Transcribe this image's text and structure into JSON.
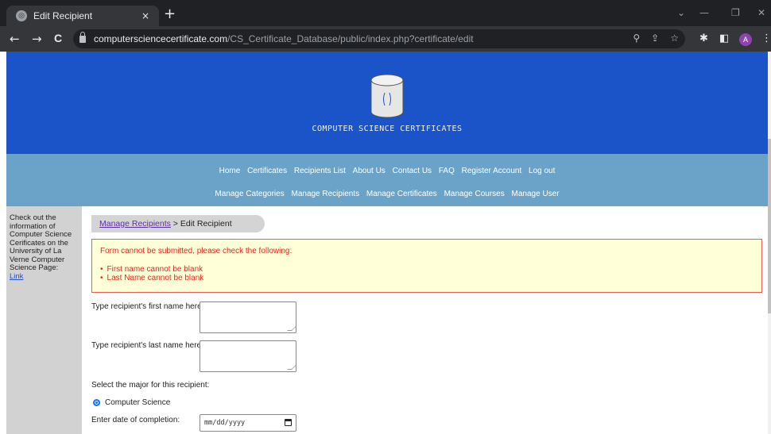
{
  "browser": {
    "tab_title": "Edit Recipient",
    "tab_close": "×",
    "new_tab": "+",
    "url_host": "computersciencecertificate.com",
    "url_path": "/CS_Certificate_Database/public/index.php?certificate/edit",
    "back": "←",
    "forward": "→",
    "reload": "C",
    "profile_initial": "A",
    "window_controls": {
      "dropdown": "⌄",
      "minimize": "—",
      "restore": "❐",
      "close": "✕"
    }
  },
  "site": {
    "logo_text": "COMPUTER SCIENCE CERTIFICATES",
    "nav_primary": [
      "Home",
      "Certificates",
      "Recipients List",
      "About Us",
      "Contact Us",
      "FAQ",
      "Register Account",
      "Log out"
    ],
    "nav_secondary": [
      "Manage Categories",
      "Manage Recipients",
      "Manage Certificates",
      "Manage Courses",
      "Manage User"
    ]
  },
  "sidebar": {
    "text": "Check out the information of Computer Science Cerificates on the University of La Verne Computer Science Page:",
    "link": "Link"
  },
  "breadcrumb": {
    "parent": "Manage Recipients",
    "separator": " > ",
    "current": "Edit Recipient"
  },
  "errors": {
    "title": "Form cannot be submitted, please check the following:",
    "items": [
      "First name cannot be blank",
      "Last Name cannot be blank"
    ]
  },
  "form": {
    "first_name_label": "Type recipient's first name here:",
    "first_name_value": "",
    "last_name_label": "Type recipient's last name here:",
    "last_name_value": "",
    "major_label": "Select the major for this recipient:",
    "major_option": "Computer Science",
    "date_label": "Enter date of completion:",
    "date_placeholder": "mm/dd/yyyy"
  },
  "colors": {
    "header_blue": "#1a54c8",
    "nav_blue": "#6ba2c8",
    "error_red": "#e0281e",
    "error_bg": "#ffffd8"
  }
}
